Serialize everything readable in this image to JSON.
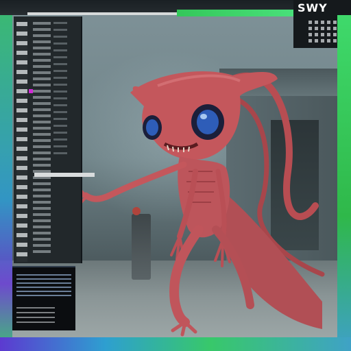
{
  "corner_widget": {
    "title": "SWY"
  },
  "scene": {
    "subject_icon": "creature-illustration",
    "accent_colors": {
      "creature": "#c4575c",
      "eyes": "#2e5db8",
      "frame_green": "#3fd96b",
      "frame_violet": "#6a3fd8"
    }
  }
}
